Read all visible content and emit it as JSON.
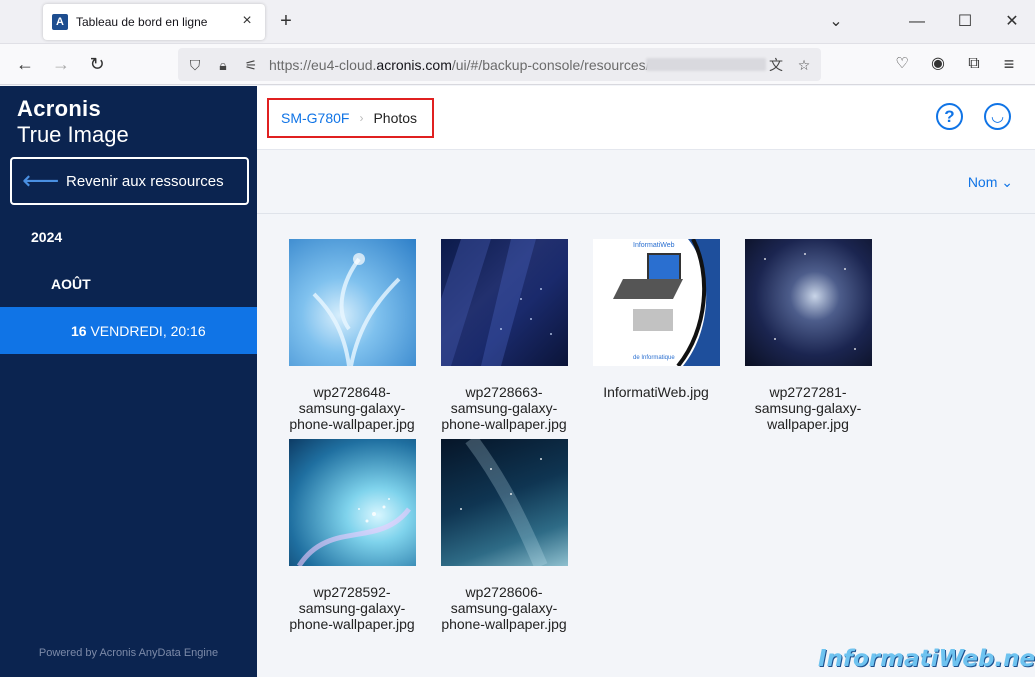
{
  "browser": {
    "tab_title": "Tableau de bord en ligne",
    "tab_favicon": "A",
    "url_prefix": "https://eu4-cloud.",
    "url_domain": "acronis.com",
    "url_path": "/ui/#/backup-console/resources/"
  },
  "sidebar": {
    "brand_line1": "Acronis",
    "brand_line2": "True Image",
    "back_label": "Revenir aux ressources",
    "year": "2024",
    "month": "AOÛT",
    "date_day": "16",
    "date_rest": " VENDREDI, 20:16",
    "powered_by": "Powered by Acronis AnyData Engine"
  },
  "breadcrumb": {
    "parent": "SM-G780F",
    "current": "Photos"
  },
  "toolbar": {
    "sort_label": "Nom"
  },
  "files": [
    {
      "name": "wp2728648-samsung-galaxy-phone-wallpaper.jpg",
      "line1": "wp2728648-",
      "line2": "samsung-galaxy-",
      "line3": "phone-wallpaper.jpg"
    },
    {
      "name": "wp2728663-samsung-galaxy-phone-wallpaper.jpg",
      "line1": "wp2728663-",
      "line2": "samsung-galaxy-",
      "line3": "phone-wallpaper.jpg"
    },
    {
      "name": "InformatiWeb.jpg",
      "line1": "InformatiWeb.jpg",
      "line2": "",
      "line3": ""
    },
    {
      "name": "wp2727281-samsung-galaxy-wallpaper.jpg",
      "line1": "wp2727281-",
      "line2": "samsung-galaxy-",
      "line3": "wallpaper.jpg"
    },
    {
      "name": "wp2728592-samsung-galaxy-phone-wallpaper.jpg",
      "line1": "wp2728592-",
      "line2": "samsung-galaxy-",
      "line3": "phone-wallpaper.jpg"
    },
    {
      "name": "wp2728606-samsung-galaxy-phone-wallpaper.jpg",
      "line1": "wp2728606-",
      "line2": "samsung-galaxy-",
      "line3": "phone-wallpaper.jpg"
    }
  ],
  "thumb_text": {
    "title": "InformatiWeb",
    "subtitle": "de Informatique"
  },
  "watermark": "InformatiWeb.net",
  "colors": {
    "sidebar_bg": "#0b2450",
    "accent_blue": "#1074e6",
    "highlight_red": "#e02020"
  }
}
